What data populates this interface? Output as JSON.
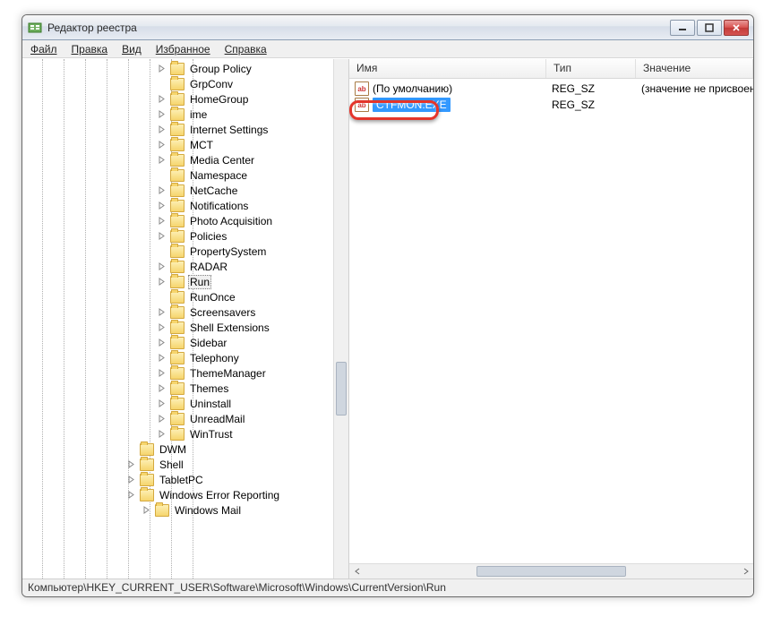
{
  "window": {
    "title": "Редактор реестра"
  },
  "menu": {
    "file": "Файл",
    "edit": "Правка",
    "view": "Вид",
    "favorites": "Избранное",
    "help": "Справка"
  },
  "tree": {
    "items": [
      {
        "label": "Group Policy",
        "exp": true,
        "lv": 0
      },
      {
        "label": "GrpConv",
        "exp": false,
        "lv": 0
      },
      {
        "label": "HomeGroup",
        "exp": true,
        "lv": 0
      },
      {
        "label": "ime",
        "exp": true,
        "lv": 0
      },
      {
        "label": "Internet Settings",
        "exp": true,
        "lv": 0
      },
      {
        "label": "MCT",
        "exp": true,
        "lv": 0
      },
      {
        "label": "Media Center",
        "exp": true,
        "lv": 0
      },
      {
        "label": "Namespace",
        "exp": false,
        "lv": 0
      },
      {
        "label": "NetCache",
        "exp": true,
        "lv": 0
      },
      {
        "label": "Notifications",
        "exp": true,
        "lv": 0
      },
      {
        "label": "Photo Acquisition",
        "exp": true,
        "lv": 0
      },
      {
        "label": "Policies",
        "exp": true,
        "lv": 0
      },
      {
        "label": "PropertySystem",
        "exp": false,
        "lv": 0
      },
      {
        "label": "RADAR",
        "exp": true,
        "lv": 0
      },
      {
        "label": "Run",
        "exp": true,
        "lv": 0,
        "selected": true
      },
      {
        "label": "RunOnce",
        "exp": false,
        "lv": 0
      },
      {
        "label": "Screensavers",
        "exp": true,
        "lv": 0
      },
      {
        "label": "Shell Extensions",
        "exp": true,
        "lv": 0
      },
      {
        "label": "Sidebar",
        "exp": true,
        "lv": 0
      },
      {
        "label": "Telephony",
        "exp": true,
        "lv": 0
      },
      {
        "label": "ThemeManager",
        "exp": true,
        "lv": 0
      },
      {
        "label": "Themes",
        "exp": true,
        "lv": 0
      },
      {
        "label": "Uninstall",
        "exp": true,
        "lv": 0
      },
      {
        "label": "UnreadMail",
        "exp": true,
        "lv": 0
      },
      {
        "label": "WinTrust",
        "exp": true,
        "lv": 0
      },
      {
        "label": "DWM",
        "exp": false,
        "lv": 1
      },
      {
        "label": "Shell",
        "exp": true,
        "lv": 1
      },
      {
        "label": "TabletPC",
        "exp": true,
        "lv": 1
      },
      {
        "label": "Windows Error Reporting",
        "exp": true,
        "lv": 1
      },
      {
        "label": "Windows Mail",
        "exp": true,
        "lv": 2
      }
    ]
  },
  "list": {
    "columns": {
      "name": "Имя",
      "type": "Тип",
      "value": "Значение"
    },
    "rows": [
      {
        "name": "(По умолчанию)",
        "type": "REG_SZ",
        "value": "(значение не присвоен",
        "highlight": false
      },
      {
        "name": "CTFMON.EXE",
        "type": "REG_SZ",
        "value": "",
        "highlight": true
      }
    ]
  },
  "statusbar": {
    "path": "Компьютер\\HKEY_CURRENT_USER\\Software\\Microsoft\\Windows\\CurrentVersion\\Run"
  },
  "icons": {
    "reg_ab": "ab"
  }
}
